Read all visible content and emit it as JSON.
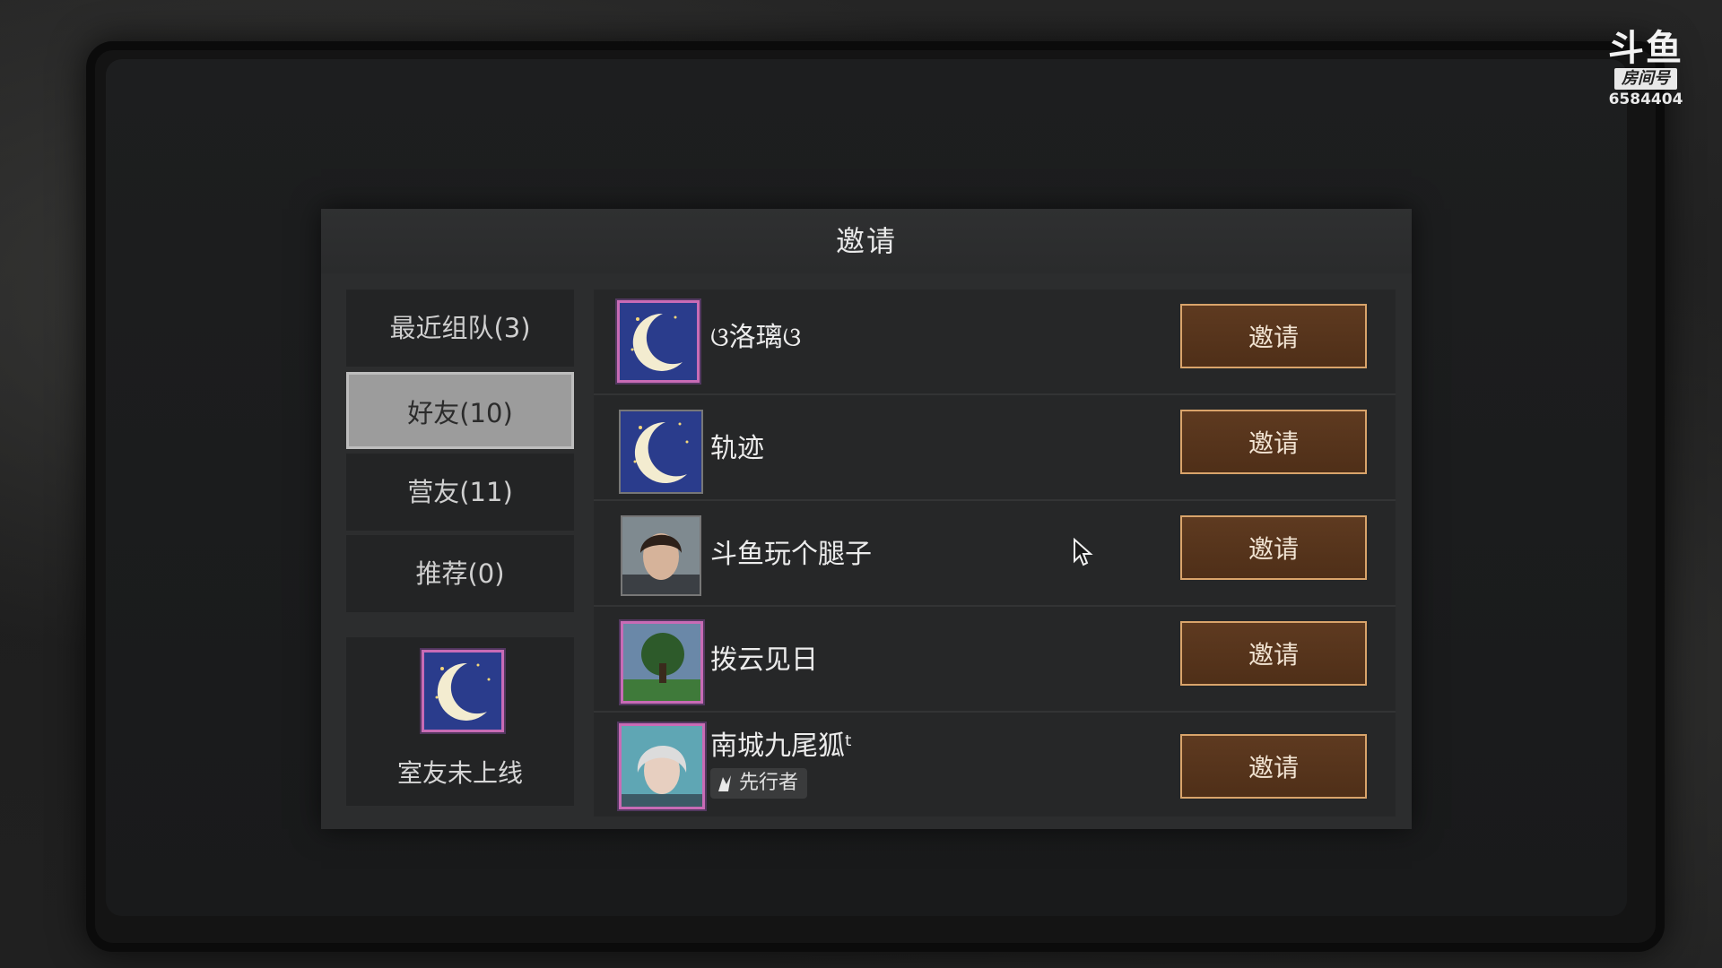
{
  "watermark": {
    "logo": "斗鱼",
    "tag": "房间号",
    "room_id": "6584404"
  },
  "dialog": {
    "title": "邀请",
    "tabs": [
      {
        "label": "最近组队(3)",
        "active": false
      },
      {
        "label": "好友(10)",
        "active": true
      },
      {
        "label": "营友(11)",
        "active": false
      },
      {
        "label": "推荐(0)",
        "active": false
      }
    ],
    "roommate": {
      "status": "室友未上线",
      "avatar": "moon-avatar-icon"
    },
    "friends": [
      {
        "name": "ଓ洛璃ଓ",
        "avatar": "moon-avatar-icon",
        "invite_label": "邀请"
      },
      {
        "name": "轨迹",
        "avatar": "moon-avatar-icon",
        "invite_label": "邀请"
      },
      {
        "name": "斗鱼玩个腿子",
        "avatar": "male-portrait-icon",
        "invite_label": "邀请"
      },
      {
        "name": "拨云见日",
        "avatar": "tree-landscape-icon",
        "invite_label": "邀请"
      },
      {
        "name": "南城九尾狐ᵗ",
        "avatar": "female-portrait-icon",
        "badge": "先行者",
        "invite_label": "邀请"
      }
    ]
  },
  "colors": {
    "accent_button": "#5e3a20",
    "button_border": "#d9a46b",
    "active_tab": "#9c9c9c",
    "frame_pink": "#c86bb5"
  }
}
